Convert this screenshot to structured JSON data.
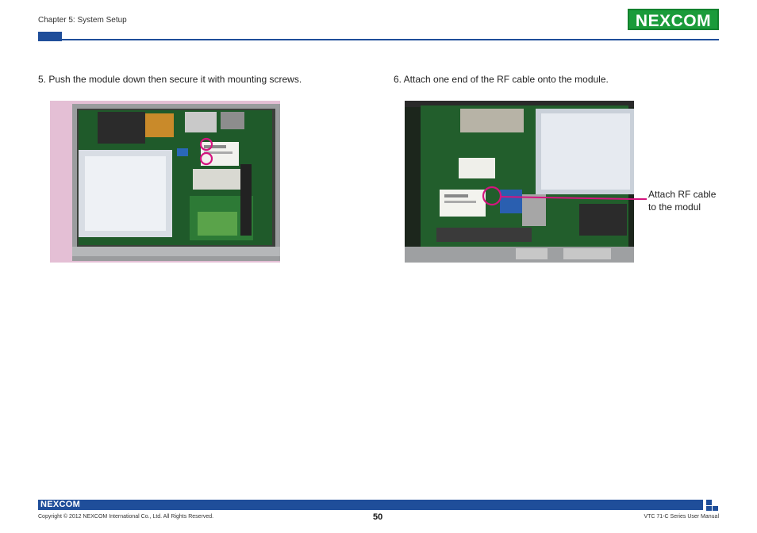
{
  "header": {
    "chapter": "Chapter 5: System Setup",
    "logo_text": "NEXCOM"
  },
  "steps": [
    {
      "caption": "5. Push the module down then secure it with mounting screws."
    },
    {
      "caption": "6. Attach one end of the RF cable onto the module."
    }
  ],
  "annotation": {
    "line1": "Attach RF cable",
    "line2": "to the modul"
  },
  "colors": {
    "accent_blue": "#1f4e9a",
    "logo_green": "#1a9b3a",
    "highlight_magenta": "#d4157f"
  },
  "footer": {
    "logo_text": "NEXCOM",
    "copyright": "Copyright © 2012 NEXCOM International Co., Ltd. All Rights Reserved.",
    "page_number": "50",
    "manual_title": "VTC 71-C Series User Manual"
  }
}
